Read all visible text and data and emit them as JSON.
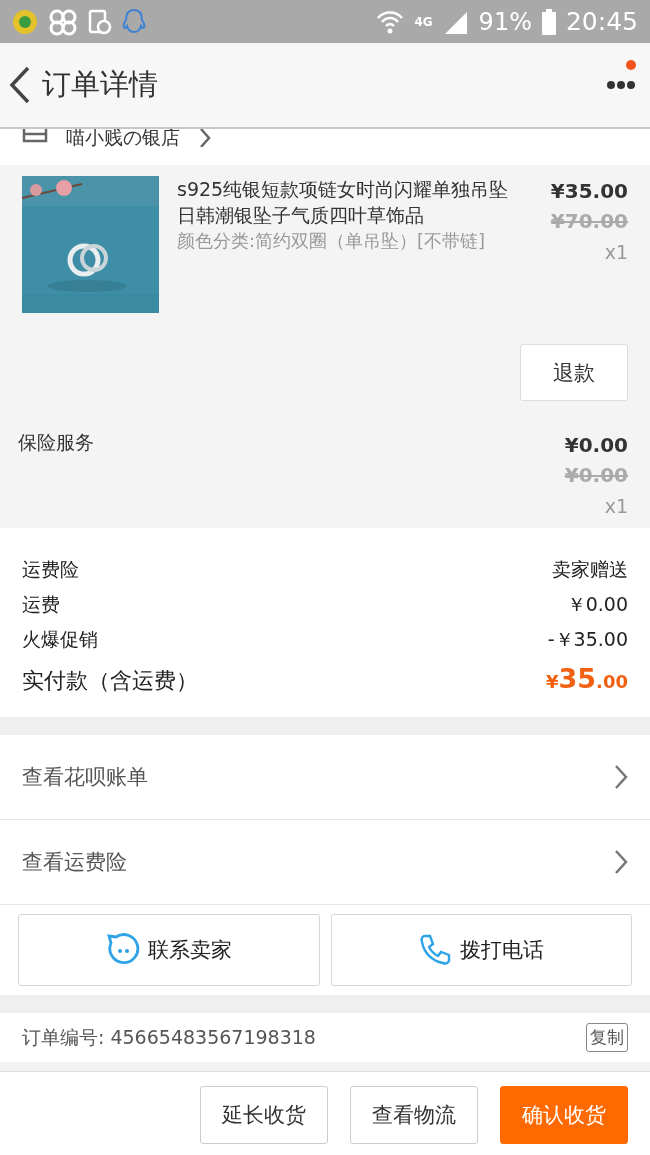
{
  "status_bar": {
    "network": "4G",
    "battery": "91%",
    "time": "20:45"
  },
  "header": {
    "title": "订单详情",
    "notification_dot": true
  },
  "shop": {
    "name": "喵小贱の银店"
  },
  "product": {
    "kind": "picture",
    "title": "s925纯银短款项链女时尚闪耀单独吊坠日韩潮银坠子气质四叶草饰品",
    "sku": "颜色分类:简约双圈（单吊坠）[不带链]",
    "price": "¥35.00",
    "original_price": "¥70.00",
    "quantity": "x1",
    "refund_button": "退款"
  },
  "insurance": {
    "title": "保险服务",
    "price": "¥0.00",
    "original_price": "¥0.00",
    "quantity": "x1"
  },
  "summary": {
    "rows": [
      {
        "label": "运费险",
        "value": "卖家赠送"
      },
      {
        "label": "运费",
        "value": "￥0.00"
      },
      {
        "label": "火爆促销",
        "value": "-￥35.00"
      }
    ],
    "total": {
      "label": "实付款（含运费）",
      "currency": "¥",
      "amount": "35",
      "cents": ".00"
    }
  },
  "links": [
    {
      "label": "查看花呗账单"
    },
    {
      "label": "查看运费险"
    }
  ],
  "contact_buttons": [
    {
      "kind": "chat",
      "label": "联系卖家"
    },
    {
      "kind": "phone",
      "label": "拨打电话"
    }
  ],
  "order": {
    "label": "订单编号:",
    "number": "45665483567198318",
    "copy_button": "复制"
  },
  "actions": [
    {
      "label": "延长收货",
      "primary": false
    },
    {
      "label": "查看物流",
      "primary": false
    },
    {
      "label": "确认收货",
      "primary": true
    }
  ]
}
